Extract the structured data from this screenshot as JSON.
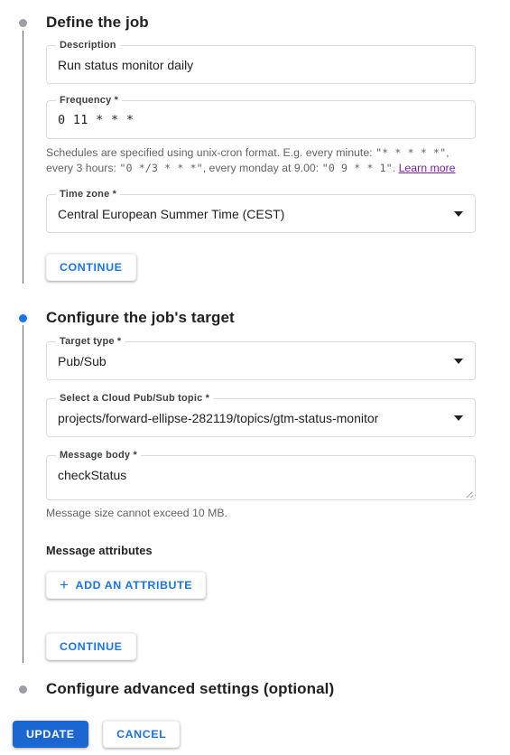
{
  "steps": [
    {
      "id": "define-the-job",
      "title": "Define the job",
      "state": "inactive",
      "dot_color": "#9aa0a6"
    },
    {
      "id": "configure-the-jobs-target",
      "title": "Configure the job's target",
      "state": "active",
      "dot_color": "#1a73e8"
    },
    {
      "id": "configure-advanced-settings",
      "title": "Configure advanced settings (optional)",
      "state": "inactive",
      "dot_color": "#9aa0a6"
    }
  ],
  "define_job": {
    "description": {
      "label": "Description",
      "value": "Run status monitor daily"
    },
    "frequency": {
      "label": "Frequency *",
      "value": "0 11 * * *"
    },
    "frequency_helper": {
      "text_1": "Schedules are specified using unix-cron format. E.g. every minute: ",
      "cron_1": "\"*  *  *  *  *\"",
      "text_2": ", every 3 hours: ",
      "cron_2": "\"0  */3  *  *  *\"",
      "text_3": ", every monday at 9.00: ",
      "cron_3": "\"0  9  *  *  1\"",
      "text_4": ". ",
      "link_label": "Learn more",
      "link_color": "#7b1fa2"
    },
    "time_zone": {
      "label": "Time zone *",
      "value": "Central European Summer Time (CEST)",
      "icon": "chevron-down-icon"
    },
    "continue_label": "CONTINUE"
  },
  "target": {
    "target_type": {
      "label": "Target type *",
      "value": "Pub/Sub",
      "icon": "chevron-down-icon"
    },
    "topic": {
      "label": "Select a Cloud Pub/Sub topic *",
      "value": "projects/forward-ellipse-282119/topics/gtm-status-monitor",
      "icon": "chevron-down-icon"
    },
    "message_body": {
      "label": "Message body *",
      "value": "checkStatus",
      "resize_icon": "resize-grip-icon"
    },
    "message_body_helper": "Message size cannot exceed 10 MB.",
    "message_attributes_label": "Message attributes",
    "add_attribute": {
      "label": "ADD AN ATTRIBUTE",
      "icon": "plus-icon"
    },
    "continue_label": "CONTINUE"
  },
  "footer": {
    "update_label": "UPDATE",
    "cancel_label": "CANCEL",
    "update_color": "#1a67d2",
    "cancel_text_color": "#1a73e8"
  }
}
